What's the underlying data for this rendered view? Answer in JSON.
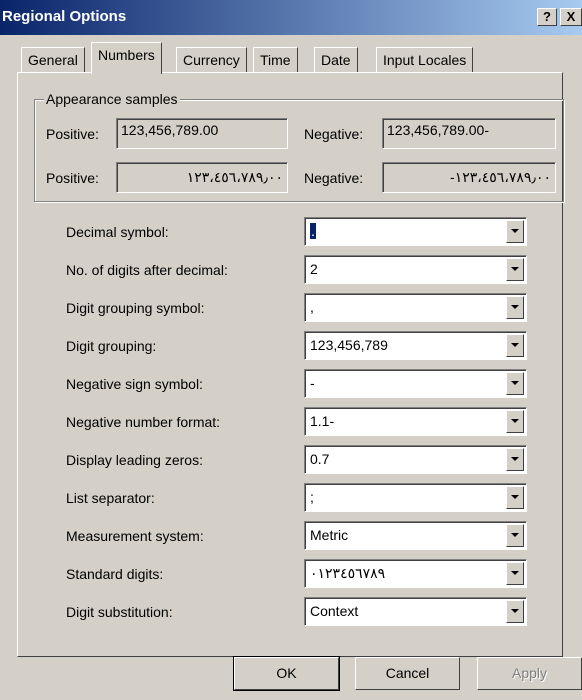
{
  "window": {
    "title": "Regional Options",
    "help_glyph": "?",
    "close_glyph": "X"
  },
  "tabs": [
    "General",
    "Numbers",
    "Currency",
    "Time",
    "Date",
    "Input Locales"
  ],
  "active_tab": "Numbers",
  "appearance": {
    "legend": "Appearance samples",
    "positive_label": "Positive:",
    "negative_label": "Negative:",
    "positive_sample": "123,456,789.00",
    "negative_sample": "123,456,789.00-",
    "positive_sample_native": "١٢٣،٤٥٦،٧٨٩٫٠٠",
    "negative_sample_native": "-١٢٣،٤٥٦،٧٨٩٫٠٠"
  },
  "settings": [
    {
      "label": "Decimal symbol:",
      "value": "."
    },
    {
      "label": "No. of digits after decimal:",
      "value": "2"
    },
    {
      "label": "Digit grouping symbol:",
      "value": ","
    },
    {
      "label": "Digit grouping:",
      "value": "123,456,789"
    },
    {
      "label": "Negative sign symbol:",
      "value": "-"
    },
    {
      "label": "Negative number format:",
      "value": "1.1-"
    },
    {
      "label": "Display leading zeros:",
      "value": "0.7"
    },
    {
      "label": "List separator:",
      "value": ";"
    },
    {
      "label": "Measurement system:",
      "value": "Metric"
    },
    {
      "label": "Standard digits:",
      "value": "٠١٢٣٤٥٦٧٨٩"
    },
    {
      "label": "Digit substitution:",
      "value": "Context"
    }
  ],
  "buttons": {
    "ok": "OK",
    "cancel": "Cancel",
    "apply": "Apply"
  }
}
